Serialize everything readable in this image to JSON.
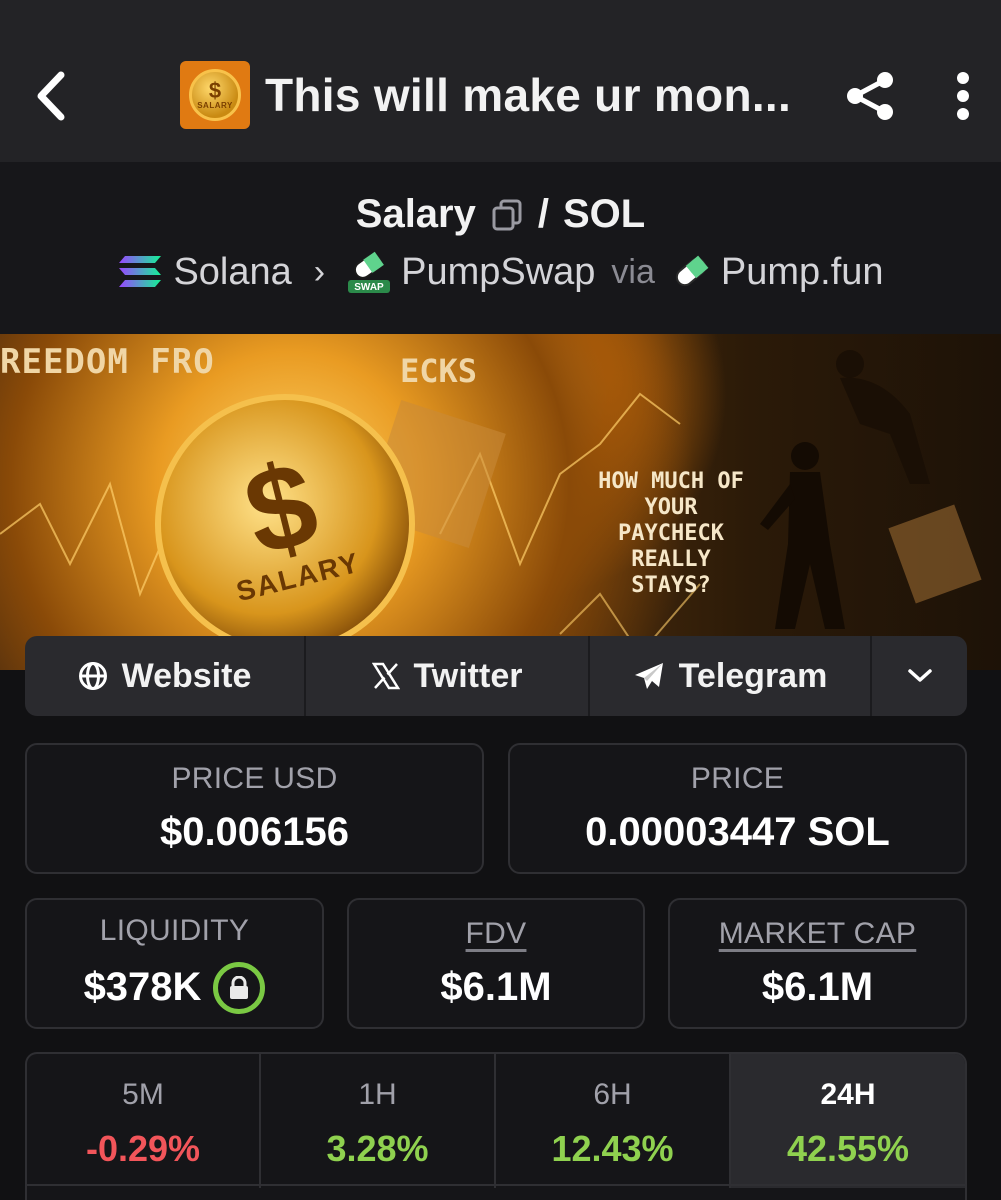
{
  "header": {
    "title": "This will make ur mon...",
    "logo_text_symbol": "$",
    "logo_text": "SALARY"
  },
  "pair": {
    "base": "Salary",
    "slash": "/",
    "quote": "SOL",
    "chain": "Solana",
    "dex": "PumpSwap",
    "dex_badge": "SWAP",
    "via": "via",
    "launchpad": "Pump.fun"
  },
  "banner": {
    "left_text": "REEDOM  FRO",
    "mid_text": "ECKS",
    "coin_symbol": "$",
    "coin_text": "SALARY",
    "question": "HOW MUCH OF YOUR PAYCHECK REALLY STAYS?"
  },
  "links": {
    "website": "Website",
    "twitter": "Twitter",
    "telegram": "Telegram"
  },
  "stats": {
    "price_usd_label": "PRICE USD",
    "price_usd": "$0.006156",
    "price_label": "PRICE",
    "price": "0.00003447 SOL",
    "liquidity_label": "LIQUIDITY",
    "liquidity": "$378K",
    "fdv_label": "FDV",
    "fdv": "$6.1M",
    "mcap_label": "MARKET CAP",
    "mcap": "$6.1M"
  },
  "timeframes": [
    {
      "label": "5M",
      "value": "-0.29%",
      "color": "#f2555a"
    },
    {
      "label": "1H",
      "value": "3.28%",
      "color": "#8fd14f"
    },
    {
      "label": "6H",
      "value": "12.43%",
      "color": "#8fd14f"
    },
    {
      "label": "24H",
      "value": "42.55%",
      "color": "#8fd14f",
      "active": true
    }
  ],
  "colors": {
    "positive": "#8fd14f",
    "negative": "#f2555a",
    "lock_ring": "#7ac943"
  }
}
